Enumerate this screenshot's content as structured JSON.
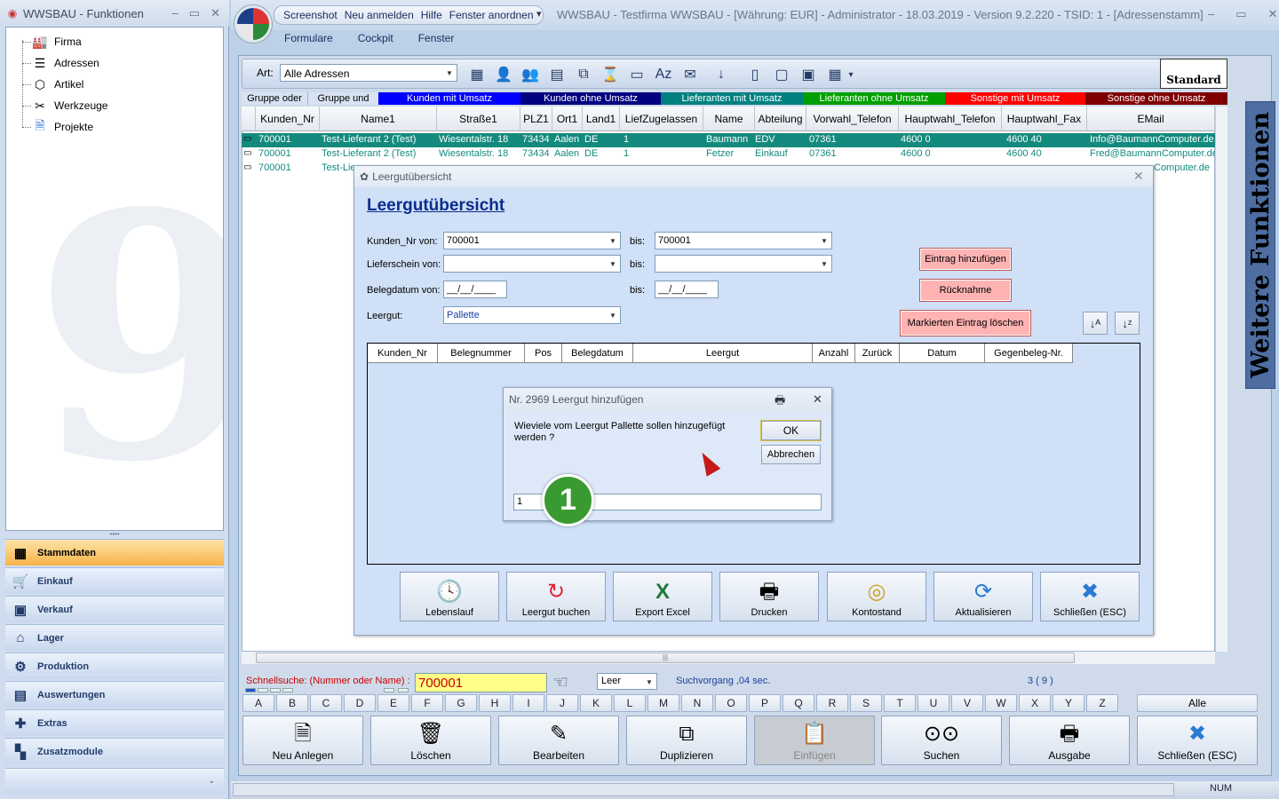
{
  "left_window": {
    "title": "WWSBAU - Funktionen",
    "controls": [
      "–",
      "▭",
      "✕"
    ],
    "tree": [
      {
        "label": "Firma",
        "icon": "factory-icon"
      },
      {
        "label": "Adressen",
        "icon": "address-card-icon"
      },
      {
        "label": "Artikel",
        "icon": "box-icon"
      },
      {
        "label": "Werkzeuge",
        "icon": "tools-icon"
      },
      {
        "label": "Projekte",
        "icon": "document-icon"
      }
    ],
    "nav": [
      {
        "label": "Stammdaten",
        "icon": "database-icon",
        "active": true
      },
      {
        "label": "Einkauf",
        "icon": "cart-icon",
        "active": false
      },
      {
        "label": "Verkauf",
        "icon": "register-icon",
        "active": false
      },
      {
        "label": "Lager",
        "icon": "warehouse-icon",
        "active": false
      },
      {
        "label": "Produktion",
        "icon": "production-icon",
        "active": false
      },
      {
        "label": "Auswertungen",
        "icon": "chart-icon",
        "active": false
      },
      {
        "label": "Extras",
        "icon": "puzzle-icon",
        "active": false
      },
      {
        "label": "Zusatzmodule",
        "icon": "modules-icon",
        "active": false
      }
    ],
    "nav_footer": "⌄"
  },
  "main_window": {
    "quick_access": [
      "Screenshot",
      "Neu anmelden",
      "Hilfe",
      "Fenster anordnen"
    ],
    "title": "WWSBAU - Testfirma WWSBAU - [Währung: EUR] - Administrator - 18.03.2019 - Version 9.2.220 - TSID: 1  - [Adressenstamm]",
    "controls": [
      "–",
      "▭",
      "✕"
    ],
    "menu": [
      "Formulare",
      "Cockpit",
      "Fenster"
    ]
  },
  "toolbar": {
    "art_label": "Art:",
    "art_value": "Alle Adressen",
    "standard_label": "Standard"
  },
  "filters": [
    {
      "label": "Gruppe oder",
      "bg": "#d7e3f2",
      "fg": "#000"
    },
    {
      "label": "Gruppe und",
      "bg": "#d7e3f2",
      "fg": "#000"
    },
    {
      "label": "Kunden mit Umsatz",
      "bg": "#0000ff",
      "fg": "#fff"
    },
    {
      "label": "Kunden ohne Umsatz",
      "bg": "#000080",
      "fg": "#fff"
    },
    {
      "label": "Lieferanten mit Umsatz",
      "bg": "#008080",
      "fg": "#fff"
    },
    {
      "label": "Lieferanten ohne Umsatz",
      "bg": "#00a000",
      "fg": "#fff"
    },
    {
      "label": "Sonstige mit Umsatz",
      "bg": "#ff0000",
      "fg": "#fff"
    },
    {
      "label": "Sonstige ohne Umsatz",
      "bg": "#800000",
      "fg": "#fff"
    }
  ],
  "grid": {
    "columns": [
      "Kunden_Nr",
      "Name1",
      "Straße1",
      "PLZ1",
      "Ort1",
      "Land1",
      "LiefZugelassen",
      "Name",
      "Abteilung",
      "Vorwahl_Telefon",
      "Hauptwahl_Telefon",
      "Hauptwahl_Fax",
      "EMail"
    ],
    "rows": [
      [
        "700001",
        "Test-Lieferant 2  (Test)",
        "Wiesentalstr. 18",
        "73434",
        "Aalen",
        "DE",
        "1",
        "Baumann",
        "EDV",
        "07361",
        "4600 0",
        "4600 40",
        "Info@BaumannComputer.de"
      ],
      [
        "700001",
        "Test-Lieferant 2  (Test)",
        "Wiesentalstr. 18",
        "73434",
        "Aalen",
        "DE",
        "1",
        "Fetzer",
        "Einkauf",
        "07361",
        "4600 0",
        "4600 40",
        "Fred@BaumannComputer.de"
      ],
      [
        "700001",
        "Test-Lie",
        "",
        "",
        "",
        "",
        "",
        "",
        "",
        "",
        "",
        "",
        "Computer.de"
      ]
    ]
  },
  "side_panel": {
    "label": "Weitere Funktionen"
  },
  "bottom": {
    "search_label": "Schnellsuche: (Nummer oder Name) :",
    "search_value": "700001",
    "leer_value": "Leer",
    "suchvorgang": "Suchvorgang ,04 sec.",
    "count": "3 ( 9 )",
    "letters": [
      "A",
      "B",
      "C",
      "D",
      "E",
      "F",
      "G",
      "H",
      "I",
      "J",
      "K",
      "L",
      "M",
      "N",
      "O",
      "P",
      "Q",
      "R",
      "S",
      "T",
      "U",
      "V",
      "W",
      "X",
      "Y",
      "Z"
    ],
    "alle": "Alle",
    "buttons": [
      {
        "label": "Neu Anlegen",
        "icon": "new-document-icon",
        "glyph": "🗎",
        "disabled": false
      },
      {
        "label": "Löschen",
        "icon": "trash-icon",
        "glyph": "🗑",
        "disabled": false
      },
      {
        "label": "Bearbeiten",
        "icon": "edit-icon",
        "glyph": "✎",
        "disabled": false
      },
      {
        "label": "Duplizieren",
        "icon": "duplicate-icon",
        "glyph": "⧉",
        "disabled": false
      },
      {
        "label": "Einfügen",
        "icon": "paste-icon",
        "glyph": "📋",
        "disabled": true
      },
      {
        "label": "Suchen",
        "icon": "binoculars-icon",
        "glyph": "⊙⊙",
        "disabled": false
      },
      {
        "label": "Ausgabe",
        "icon": "printer-icon",
        "glyph": "🖶",
        "disabled": false
      },
      {
        "label": "Schließen (ESC)",
        "icon": "close-x-icon",
        "glyph": "✖",
        "disabled": false
      }
    ],
    "status_num": "NUM"
  },
  "leergut": {
    "title": "Leergutübersicht",
    "heading": "Leergutübersicht",
    "kunden_label": "Kunden_Nr von:",
    "kunden_von": "700001",
    "kunden_bis": "700001",
    "bis_label": "bis:",
    "lieferschein_label": "Lieferschein von:",
    "belegdatum_label": "Belegdatum von:",
    "date_placeholder": "__/__/____",
    "leergut_label": "Leergut:",
    "leergut_value": "Pallette",
    "btn_add": "Eintrag hinzufügen",
    "btn_ruecknahme": "Rücknahme",
    "btn_delete": "Markierten Eintrag löschen",
    "columns": [
      "Kunden_Nr",
      "Belegnummer",
      "Pos",
      "Belegdatum",
      "Leergut",
      "Anzahl",
      "Zurück",
      "Datum",
      "Gegenbeleg-Nr."
    ],
    "buttons": [
      {
        "label": "Lebenslauf",
        "icon": "clock-document-icon",
        "glyph": "🕓"
      },
      {
        "label": "Leergut buchen",
        "icon": "refresh-book-icon",
        "glyph": "↻"
      },
      {
        "label": "Export Excel",
        "icon": "excel-icon",
        "glyph": "X"
      },
      {
        "label": "Drucken",
        "icon": "printer-icon",
        "glyph": "🖶"
      },
      {
        "label": "Kontostand",
        "icon": "coins-jar-icon",
        "glyph": "◎"
      },
      {
        "label": "Aktualisieren",
        "icon": "refresh-icon",
        "glyph": "⟳"
      },
      {
        "label": "Schließen (ESC)",
        "icon": "close-x-icon",
        "glyph": "✖"
      }
    ]
  },
  "dialog": {
    "title": "Nr. 2969 Leergut hinzufügen",
    "message": "Wieviele vom Leergut Pallette sollen hinzugefügt werden ?",
    "ok": "OK",
    "cancel": "Abbrechen",
    "input_value": "1"
  },
  "step_badge": "1"
}
